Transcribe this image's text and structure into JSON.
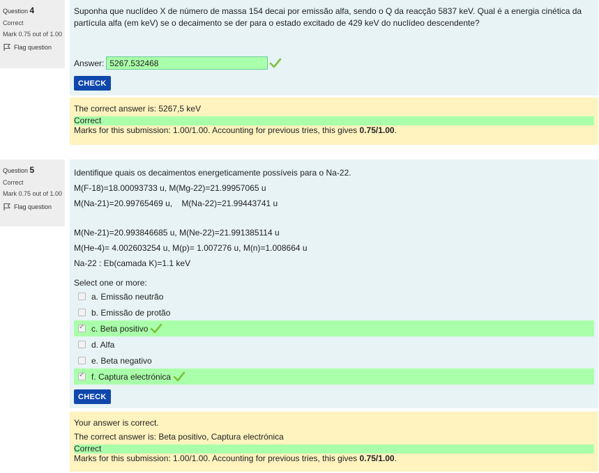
{
  "q4": {
    "label": "Question",
    "number": "4",
    "state": "Correct",
    "grade": "Mark 0.75 out of 1.00",
    "flag_label": "Flag question",
    "text": "Suponha que nuclídeo X de número de massa 154 decai por emissão alfa, sendo o Q da reacção 5837 keV. Qual é a energia cinética da partícula alfa (em keV) se o decaimento se der para o estado excitado de 429 keV do nuclídeo descendente?",
    "answer_label": "Answer:",
    "answer_value": "5267.532468",
    "check_label": "CHECK",
    "correct_answer": "The correct answer is: 5267,5 keV",
    "correct_text": "Correct",
    "marks_text": "Marks for this submission: 1.00/1.00. Accounting for previous tries, this gives ",
    "marks_bold": "0.75/1.00",
    "marks_end": "."
  },
  "q5": {
    "label": "Question",
    "number": "5",
    "state": "Correct",
    "grade": "Mark 0.75 out of 1.00",
    "flag_label": "Flag question",
    "lines": {
      "l1": "Identifique quais os decaimentos  energeticamente possíveis para o Na-22.",
      "l2": "M(F-18)=18.00093733 u, M(Mg-22)=21.99957065 u",
      "l3a": "M(Na-21)=20.99765469 u,    ",
      "l3b": "M(Na-22)=21.99443741 u",
      "l4": "M(Ne-21)=20.993846685 u,  M(Ne-22)=21.991385114 u",
      "l5": "M(He-4)= 4.002603254 u,  M(p)= 1.007276 u,  M(n)=1.008664 u",
      "l6": "Na-22 : Eb(camada K)=1.1 keV"
    },
    "select_label": "Select one or more:",
    "options": [
      {
        "label": "a. Emissão neutrão",
        "checked": false,
        "correct": false
      },
      {
        "label": "b. Emissão de protão",
        "checked": false,
        "correct": false
      },
      {
        "label": "c. Beta positivo",
        "checked": true,
        "correct": true
      },
      {
        "label": "d. Alfa",
        "checked": false,
        "correct": false
      },
      {
        "label": "e. Beta negativo",
        "checked": false,
        "correct": false
      },
      {
        "label": "f. Captura electrónica",
        "checked": true,
        "correct": true
      }
    ],
    "check_label": "CHECK",
    "your_answer": "Your answer is correct.",
    "correct_answer": "The correct answer is: Beta positivo, Captura electrónica",
    "correct_text": "Correct",
    "marks_text": "Marks for this submission: 1.00/1.00. Accounting for previous tries, this gives ",
    "marks_bold": "0.75/1.00",
    "marks_end": "."
  },
  "colors": {
    "check_button": "#0f47ad",
    "correct_green": "#aaffaa",
    "formulation_bg": "#e7f3f5",
    "outcome_bg": "#fff3bf",
    "tick_green": "#7cc23a"
  }
}
